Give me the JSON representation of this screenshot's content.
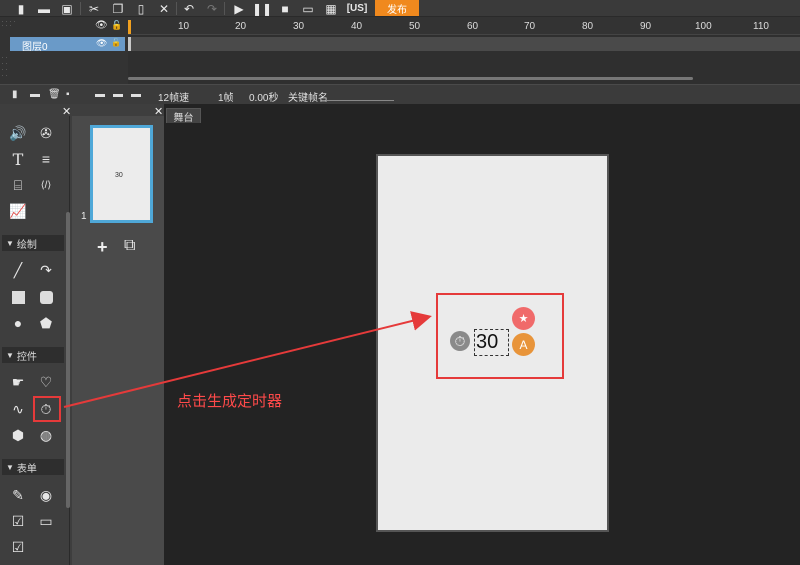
{
  "toolbar": {
    "icons": [
      "new-file-icon",
      "open-file-icon",
      "save-icon",
      "cut-icon",
      "copy-icon",
      "paste-icon",
      "delete-icon",
      "undo-icon",
      "redo-icon",
      "play-icon",
      "pause-icon",
      "stop-icon",
      "preview-icon",
      "export-icon"
    ],
    "export_label": "[US]",
    "publish_label": "发布"
  },
  "timeline": {
    "ruler_ticks": [
      "10",
      "20",
      "30",
      "40",
      "50",
      "60",
      "70",
      "80",
      "90",
      "100",
      "110"
    ],
    "layer_name": "图层0"
  },
  "status_bar": {
    "fps": "12帧速",
    "frame": "1帧",
    "time": "0.00秒",
    "keyframe_name_label": "关键帧名"
  },
  "pages_panel": {
    "thumbnail_text": "30",
    "page_number": "1"
  },
  "tools_panel": {
    "sections": {
      "draw": "绘制",
      "controls": "控件",
      "form": "表单"
    }
  },
  "stage": {
    "tab_label": "舞台",
    "timer_value": "30"
  },
  "annotation": {
    "callout_text": "点击生成定时器",
    "accent": "#e53a3a"
  },
  "colors": {
    "publish": "#f0891e",
    "layer_selected": "#6a9ac8",
    "canvas_bg": "#ebebeb",
    "badge_red": "#f06a6a",
    "badge_orange": "#e8943a"
  }
}
